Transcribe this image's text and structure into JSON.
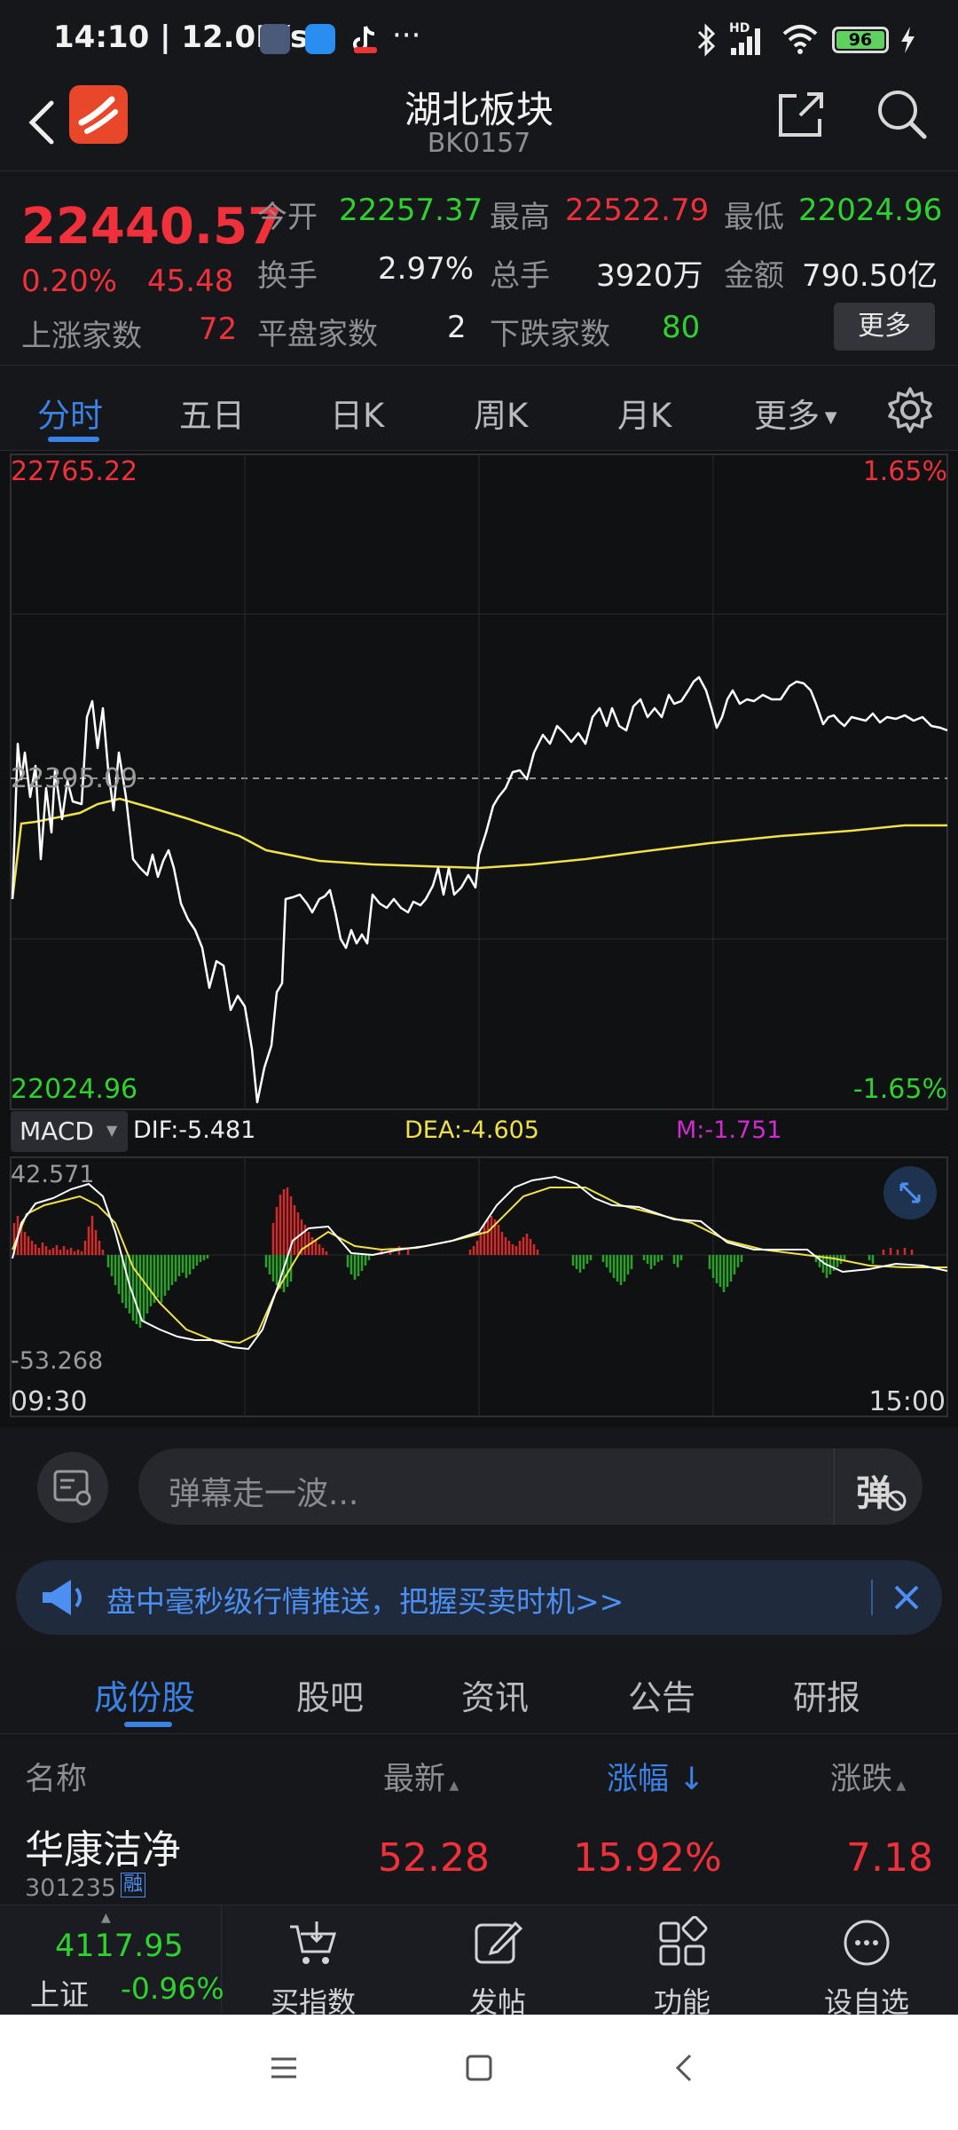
{
  "status_bar": {
    "time_speed": "14:10 | 12.0K/s",
    "more": "···",
    "battery": "96",
    "network": "HD"
  },
  "header": {
    "title": "湖北板块",
    "code": "BK0157"
  },
  "quote": {
    "price": "22440.57",
    "change_pct": "0.20%",
    "change": "45.48",
    "open_label": "今开",
    "open": "22257.37",
    "high_label": "最高",
    "high": "22522.79",
    "low_label": "最低",
    "low": "22024.96",
    "turnover_label": "换手",
    "turnover": "2.97%",
    "volume_label": "总手",
    "volume": "3920万",
    "amount_label": "金额",
    "amount": "790.50亿",
    "up_label": "上涨家数",
    "up": "72",
    "flat_label": "平盘家数",
    "flat": "2",
    "down_label": "下跌家数",
    "down": "80",
    "more_button": "更多"
  },
  "tabs": [
    "分时",
    "五日",
    "日K",
    "周K",
    "月K",
    "更多"
  ],
  "chart": {
    "top_value": "22765.22",
    "top_pct": "1.65%",
    "mid_value": "22395.09",
    "bottom_value": "22024.96",
    "bottom_pct": "-1.65%",
    "macd_label": "MACD",
    "dif": "DIF:-5.481",
    "dea": "DEA:-4.605",
    "m": "M:-1.751",
    "macd_top": "42.571",
    "macd_bottom": "-53.268",
    "time_start": "09:30",
    "time_end": "15:00",
    "colors": {
      "price_line": "#ffffff",
      "avg_line": "#f0e04a",
      "up_bar": "#d42a2a",
      "down_bar": "#27a327"
    }
  },
  "danmaku": {
    "placeholder": "弹幕走一波...",
    "toggle_label": "弹"
  },
  "banner": {
    "text": "盘中毫秒级行情推送，把握买卖时机>>"
  },
  "sub_tabs": [
    "成份股",
    "股吧",
    "资讯",
    "公告",
    "研报"
  ],
  "table": {
    "headers": {
      "name": "名称",
      "latest": "最新",
      "change_pct": "涨幅",
      "change": "涨跌"
    },
    "rows": [
      {
        "name": "华康洁净",
        "code": "301235",
        "tag": "融",
        "latest": "52.28",
        "change_pct": "15.92%",
        "change": "7.18"
      }
    ]
  },
  "bottom_nav": {
    "index_value": "4117.95",
    "index_name": "上证",
    "index_pct": "-0.96%",
    "items": [
      "买指数",
      "发帖",
      "功能",
      "设自选"
    ]
  }
}
